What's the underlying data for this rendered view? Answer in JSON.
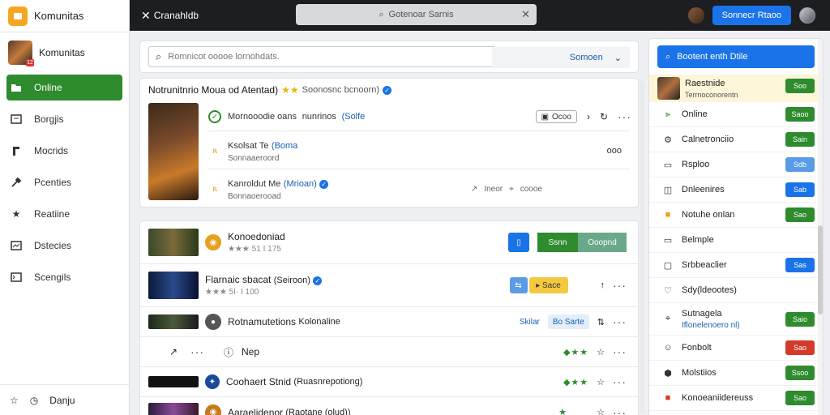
{
  "sidebar": {
    "title": "Komunitas",
    "user_name": "Komunitas",
    "user_badge": "12",
    "items": [
      {
        "label": "Online",
        "icon": "folder-icon",
        "active": true
      },
      {
        "label": "Borgjis",
        "icon": "book-icon"
      },
      {
        "label": "Mocrids",
        "icon": "music-icon"
      },
      {
        "label": "Pcenties",
        "icon": "wrench-icon"
      },
      {
        "label": "Reatiine",
        "icon": "star-icon"
      },
      {
        "label": "Dstecies",
        "icon": "monitor-icon"
      },
      {
        "label": "Scengils",
        "icon": "terminal-icon"
      }
    ],
    "footer_label": "Danju"
  },
  "topbar": {
    "brand": "Cranahldb",
    "search_placeholder": "Gotenoar Sarnis",
    "button_label": "Sonnecr Rtaoo"
  },
  "main": {
    "search_placeholder": "Romnicot ooooe lornohdats.",
    "sort_label": "Somoen",
    "feature": {
      "title": "Notrunitnrio Moua od Atentad)",
      "subtitle": "Soonosnc bcnoorn)",
      "rows": [
        {
          "name": "Mornooodie oans",
          "sub": "nunrinos",
          "tag": "(Solfe",
          "chip": "Ocoo"
        },
        {
          "name": "Ksolsat Te",
          "tag": "(Boma",
          "sub": "Sonnaaeroord",
          "count": "ooo"
        },
        {
          "name": "Kanroldut Me",
          "tag": "(Mrioan)",
          "sub": "Bonnaoerooad",
          "meta1": "Ineor",
          "meta2": "coooe"
        }
      ]
    },
    "list": [
      {
        "name": "Konoedoniad",
        "meta": "★★★ 51 I 175",
        "btn1": "Ssnn",
        "btn2": "Ooopnd"
      },
      {
        "name": "Flarnaic sbacat",
        "tag": "(Seiroon)",
        "meta": "★★★ 5I· I 100",
        "btn": "Sace"
      },
      {
        "name": "Rotnamutetions",
        "tag": "Kolonaline",
        "action1": "Skilar",
        "action2": "Bo Sarte"
      },
      {
        "name": "Nep"
      },
      {
        "name": "Coohaert Stnid",
        "tag": "(Ruasnrepotiong)"
      },
      {
        "name": "Aaraelidenor",
        "tag": "(Raotane (olud))"
      }
    ]
  },
  "right": {
    "button_label": "Bootent enth Dtile",
    "top_name": "Raestnide",
    "top_sub": "Terrnoconorentn",
    "top_badge": "Soo",
    "items": [
      {
        "label": "Online",
        "badge": "Saoo",
        "color": "green",
        "icon": "chart-icon"
      },
      {
        "label": "Calnetronciio",
        "badge": "Sain",
        "color": "green",
        "icon": "gear-icon"
      },
      {
        "label": "Rsploo",
        "badge": "Sdb",
        "color": "lblue",
        "icon": "square-icon"
      },
      {
        "label": "Dnleenires",
        "badge": "Sab",
        "color": "blue",
        "icon": "chart-icon"
      },
      {
        "label": "Notuhe onlan",
        "badge": "Sao",
        "color": "green",
        "icon": "folder-icon"
      },
      {
        "label": "Belmple",
        "badge": "",
        "color": "",
        "icon": "square-icon"
      },
      {
        "label": "Srbbeaclier",
        "badge": "Sas",
        "color": "blue",
        "icon": "chat-icon"
      },
      {
        "label": "Sdy(ldeootes)",
        "badge": "",
        "color": "",
        "icon": "heart-icon"
      },
      {
        "label": "Sutnagela",
        "sub": "Iflonelenoero nl)",
        "badge": "Saio",
        "color": "green",
        "icon": "pin-icon"
      },
      {
        "label": "Fonbolt",
        "badge": "Sao",
        "color": "red",
        "icon": "face-icon"
      },
      {
        "label": "Molstiios",
        "badge": "Ssoo",
        "color": "green",
        "icon": "shield-icon"
      },
      {
        "label": "Konoeaniidereuss",
        "badge": "Sao",
        "color": "green",
        "icon": "block-icon"
      }
    ]
  }
}
